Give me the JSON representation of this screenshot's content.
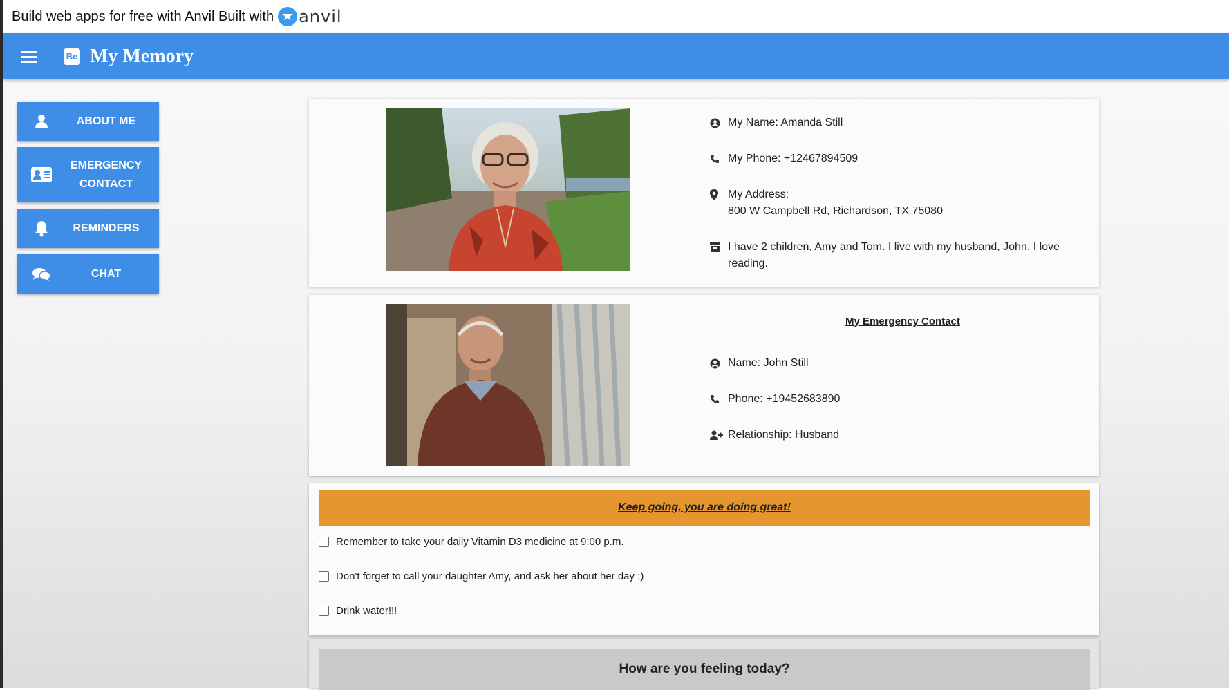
{
  "banner": {
    "text": "Build web apps for free with Anvil Built with",
    "logo_word": "anvil"
  },
  "header": {
    "badge": "Be",
    "title": "My Memory"
  },
  "sidebar": {
    "items": [
      {
        "label": "ABOUT ME",
        "icon": "user-icon"
      },
      {
        "label": "EMERGENCY CONTACT",
        "icon": "id-card-icon"
      },
      {
        "label": "REMINDERS",
        "icon": "bell-icon"
      },
      {
        "label": "CHAT",
        "icon": "chat-bubbles-icon"
      }
    ]
  },
  "about": {
    "photo": "portrait-elderly-woman",
    "name": "My Name: Amanda Still",
    "phone": "My Phone: +12467894509",
    "address_label": "My Address:",
    "address": "800 W Campbell Rd, Richardson, TX 75080",
    "bio": "I have 2 children, Amy and Tom. I live with my husband, John. I love reading."
  },
  "emergency": {
    "photo": "portrait-elderly-man",
    "title": "My Emergency Contact",
    "name": "Name: John Still",
    "phone": "Phone: +19452683890",
    "relationship": "Relationship: Husband"
  },
  "reminders": {
    "encouragement": "Keep going, you are doing great!",
    "items": [
      {
        "text": "Remember to take your daily Vitamin D3 medicine at 9:00 p.m.",
        "checked": false
      },
      {
        "text": "Don't forget to call your daughter Amy, and ask her about her day :)",
        "checked": false
      },
      {
        "text": "Drink water!!!",
        "checked": false
      }
    ]
  },
  "feeling": {
    "prompt": "How are you feeling today?"
  },
  "colors": {
    "primary": "#3e8ee8",
    "accent_orange": "#e6962f",
    "feeling_bg": "#c9c9c9"
  }
}
